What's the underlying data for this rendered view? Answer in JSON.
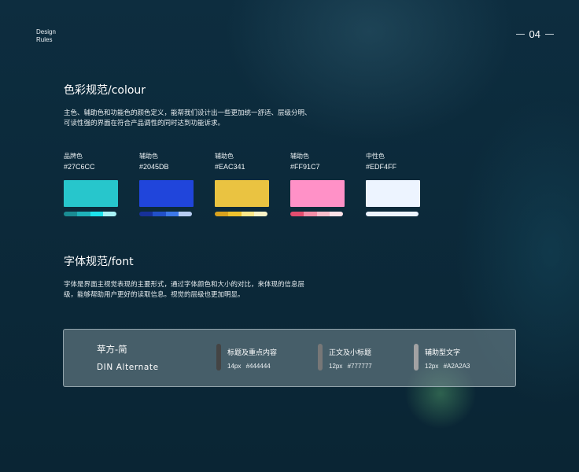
{
  "header": {
    "brand_line1": "Design",
    "brand_line2": "Rules",
    "page_number": "04"
  },
  "colour": {
    "title": "色彩规范/colour",
    "description_line1": "主色、辅助色和功能色的颜色定义，能帮我们设计出一些更加统一舒适、层级分明、",
    "description_line2": "可读性强的界面在符合产品调性的同时达到功能诉求。",
    "swatches": [
      {
        "role": "品牌色",
        "hex": "#27C6CC",
        "color": "#27C6CC",
        "shades": [
          "#1a8c93",
          "#1fb3b9",
          "#1de3ec",
          "#a9f3f6"
        ]
      },
      {
        "role": "辅助色",
        "hex": "#2045DB",
        "color": "#2045DB",
        "shades": [
          "#173199",
          "#2250c8",
          "#3d78e8",
          "#b7cdf2"
        ]
      },
      {
        "role": "辅助色",
        "hex": "#EAC341",
        "color": "#EAC341",
        "shades": [
          "#d9a21e",
          "#efc22e",
          "#fde88a",
          "#fbf3c8"
        ]
      },
      {
        "role": "辅助色",
        "hex": "#FF91C7",
        "color": "#FF91C7",
        "shades": [
          "#e34d6f",
          "#f48ea8",
          "#f9bccb",
          "#fde2e8"
        ]
      },
      {
        "role": "中性色",
        "hex": "#EDF4FF",
        "color": "#EDF4FF",
        "shades": [
          "#edf4ff",
          "#edf4ff",
          "#edf4ff",
          "#edf4ff"
        ]
      }
    ]
  },
  "font": {
    "title": "字体规范/font",
    "description_line1": "字体是界面主视觉表现的主要形式，通过字体颜色和大小的对比，来体现的信息层",
    "description_line2": "级，能够帮助用户更好的读取信息。视觉的层级也更加明显。",
    "typeface_cn": "苹方-简",
    "typeface_en": "DIN Alternate",
    "specs": [
      {
        "label": "标题及重点内容",
        "meta": "14px #444444",
        "color": "#444444"
      },
      {
        "label": "正文及小标题",
        "meta": "12px #777777",
        "color": "#777777"
      },
      {
        "label": "辅助型文字",
        "meta": "12px #A2A2A3",
        "color": "#A2A2A3"
      }
    ]
  }
}
